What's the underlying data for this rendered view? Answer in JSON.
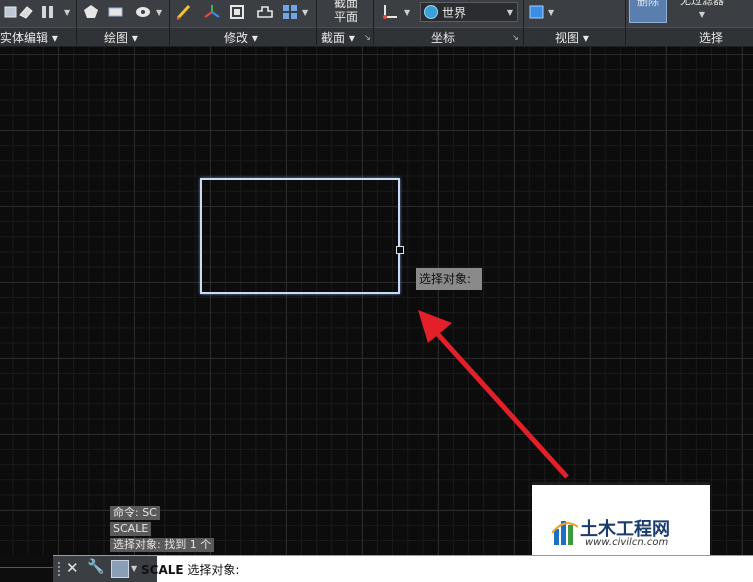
{
  "ribbon": {
    "panels": [
      {
        "label": "实体编辑"
      },
      {
        "label": "绘图"
      },
      {
        "label": "修改"
      },
      {
        "label": "截面"
      },
      {
        "label": "坐标"
      },
      {
        "label": "视图"
      },
      {
        "label": "选择"
      }
    ],
    "section_plane_line1": "截面",
    "section_plane_line2": "平面",
    "ucs_world": "世界",
    "delete_label": "删除",
    "filter_label": "无过滤器"
  },
  "drawing": {
    "tooltip": "选择对象:",
    "history": [
      "命令: SC",
      "SCALE",
      "选择对象: 找到 1 个"
    ]
  },
  "command_line": {
    "command": "SCALE",
    "prompt": "选择对象:"
  },
  "watermark": {
    "title": "土木工程网",
    "url": "www.civilcn.com"
  },
  "colors": {
    "ribbon_bg": "#3b3e42",
    "canvas_bg": "#0c0c0c",
    "selection": "#c9dcf6",
    "arrow": "#e3202a"
  }
}
